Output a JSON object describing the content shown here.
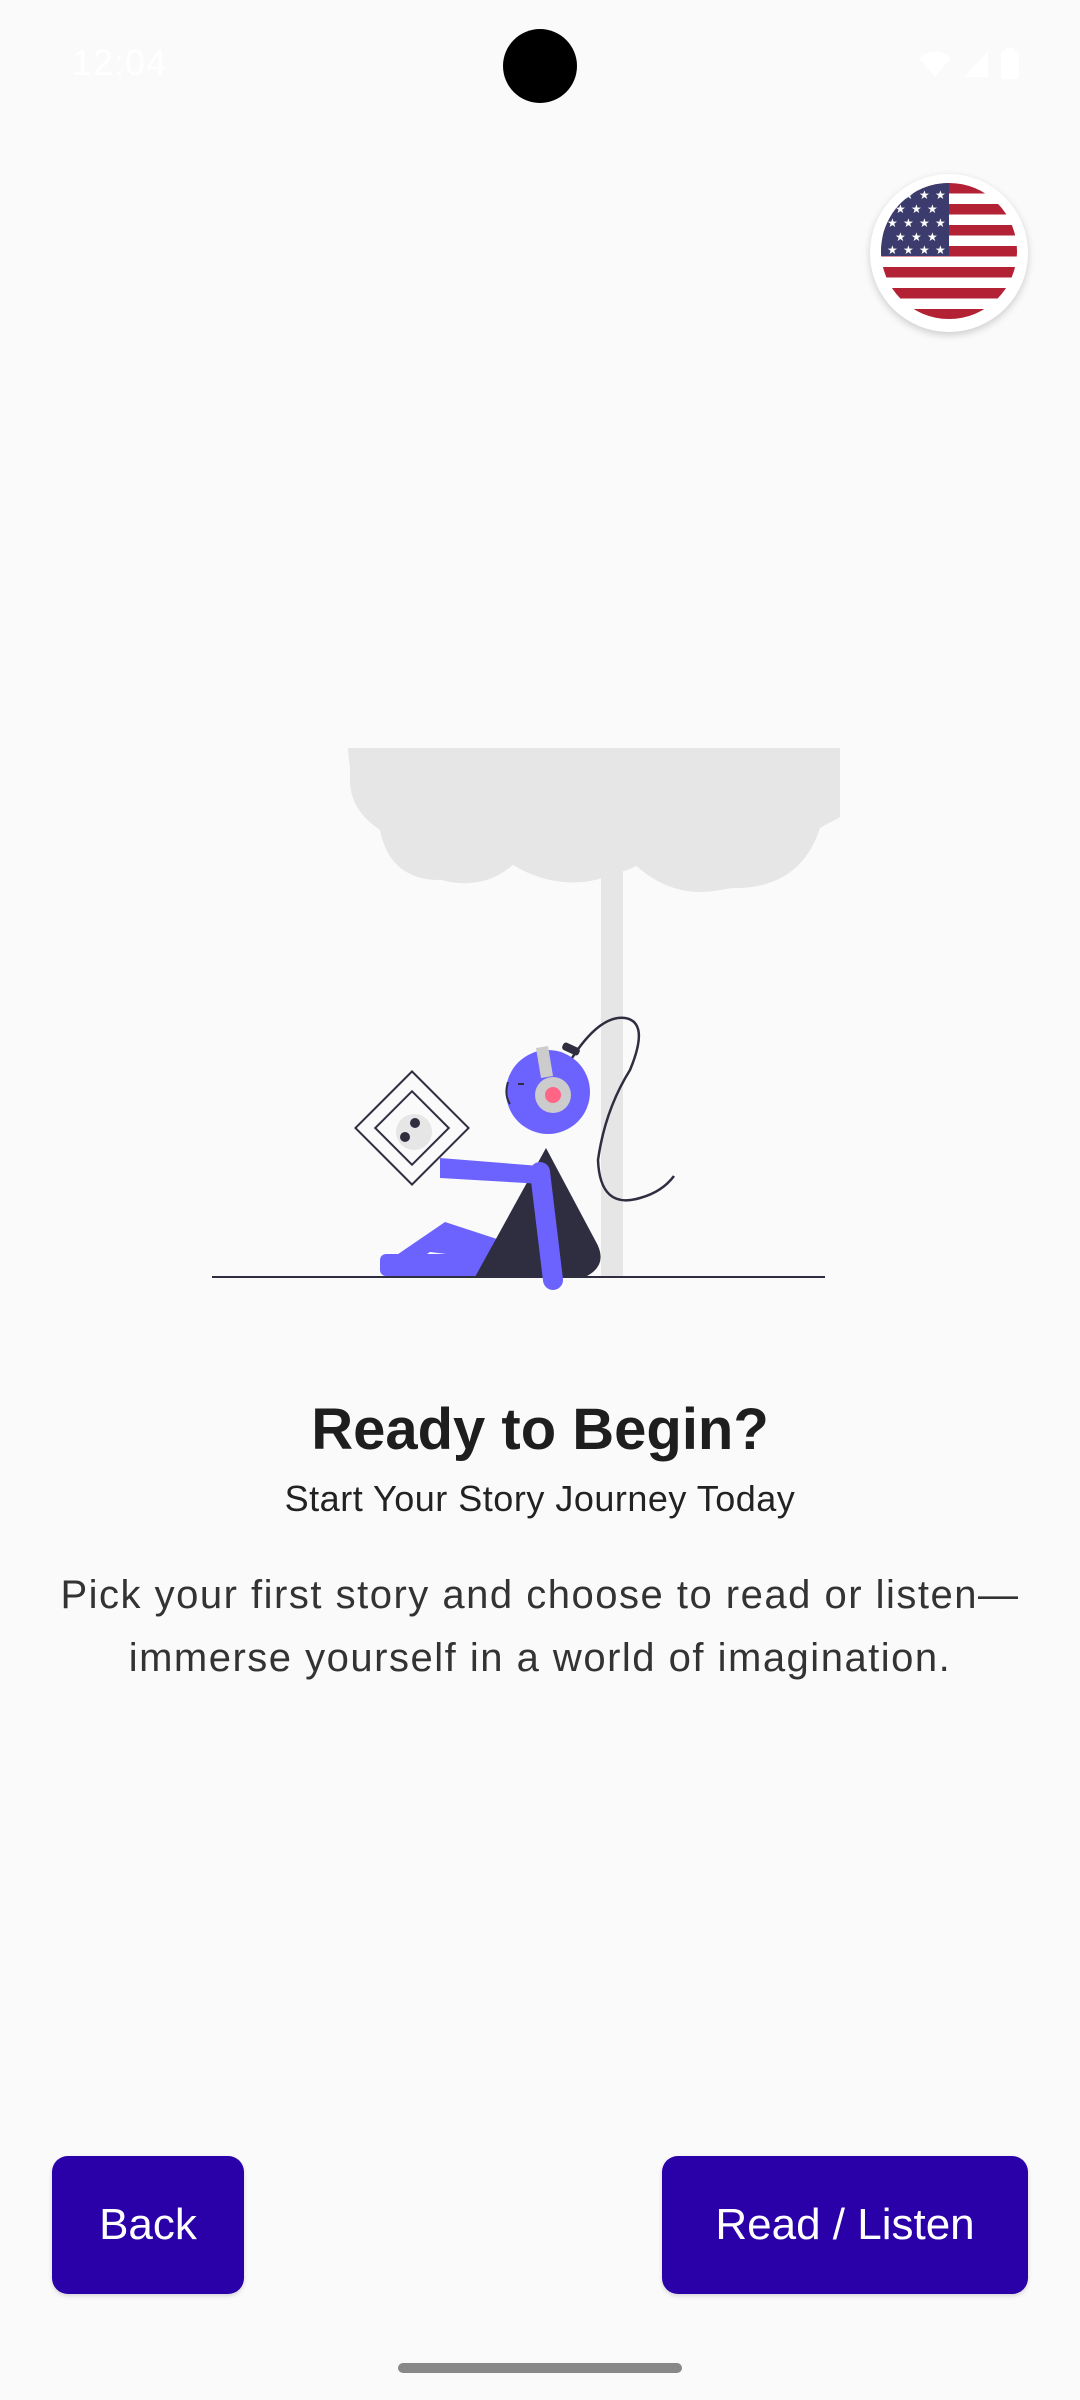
{
  "status_bar": {
    "time": "12:04",
    "icons": [
      "wifi-icon",
      "signal-icon",
      "battery-icon"
    ]
  },
  "language": {
    "flag": "us-flag-icon"
  },
  "content": {
    "title": "Ready to Begin?",
    "subtitle": "Start Your Story Journey Today",
    "description": "Pick your first story and choose to read or listen—immerse yourself in a world of imagination."
  },
  "buttons": {
    "back_label": "Back",
    "read_label": "Read / Listen"
  },
  "colors": {
    "background": "#fafafa",
    "primary_button": "#2a00a8",
    "accent_purple": "#6c63ff",
    "dark_figure": "#2f2e41",
    "tree_gray": "#e6e6e6",
    "headphone_pink": "#ff6584"
  }
}
